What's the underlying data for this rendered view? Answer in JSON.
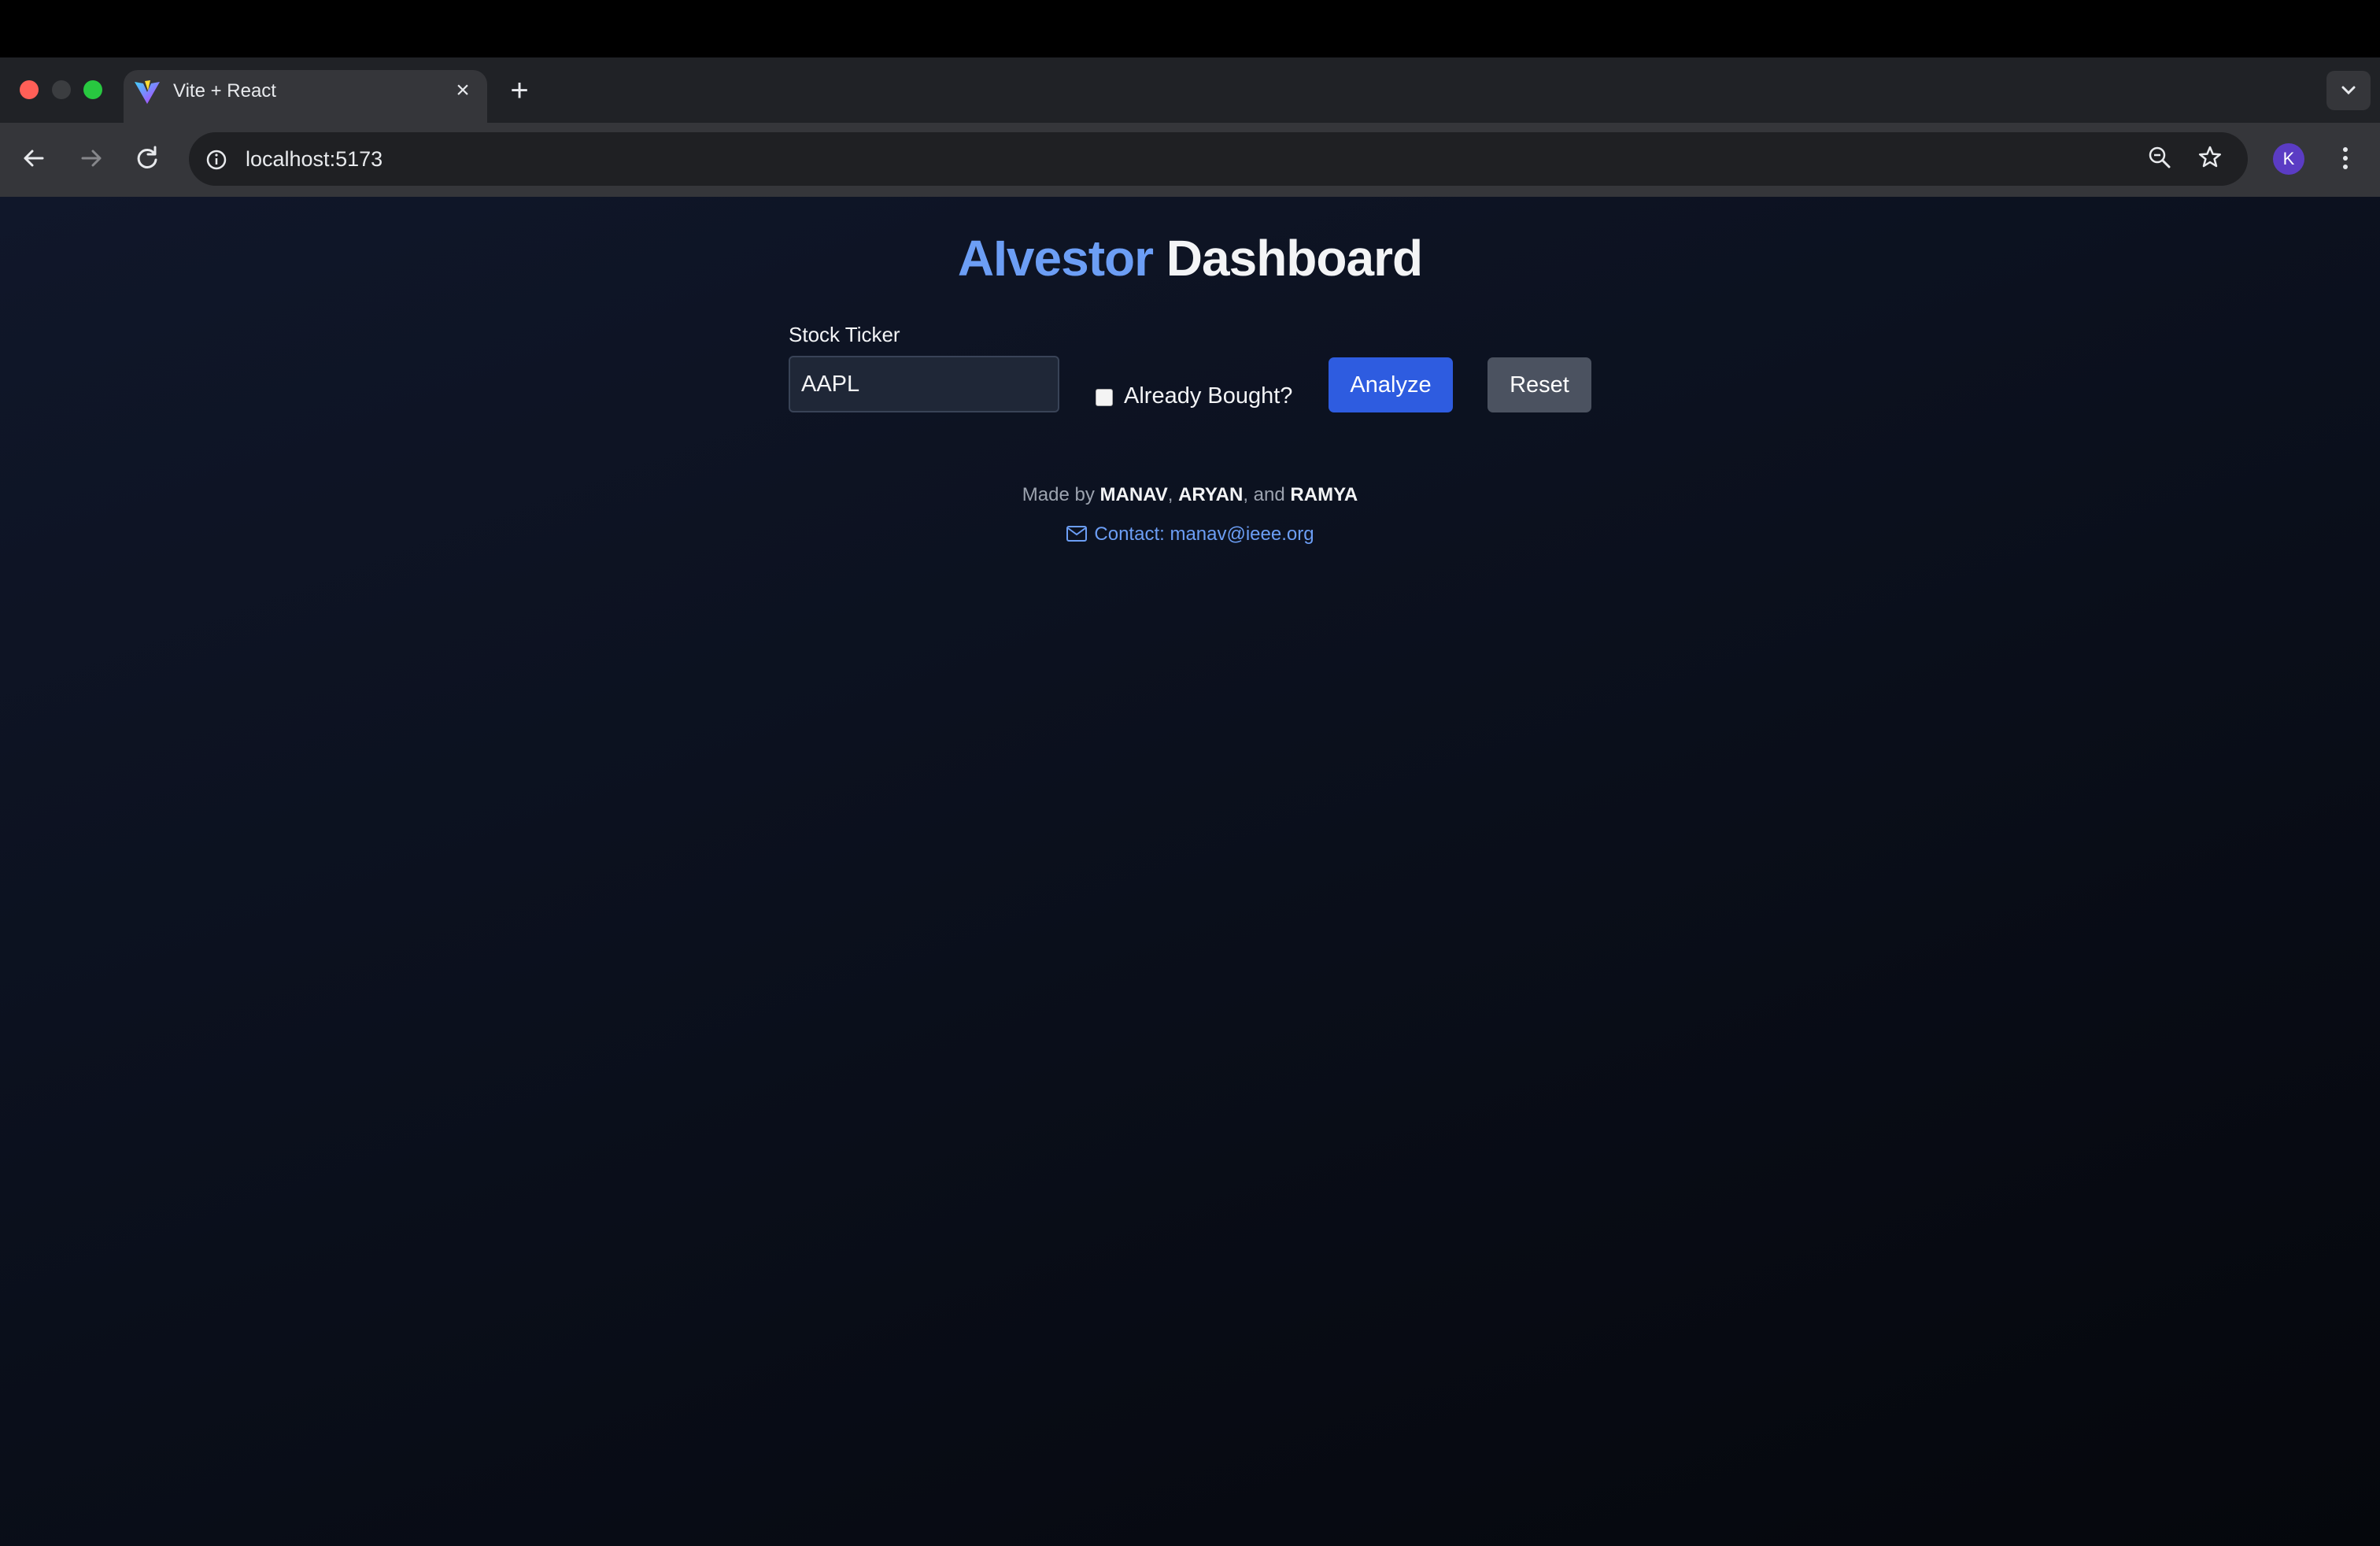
{
  "browser": {
    "tab_title": "Vite + React",
    "tab_close_glyph": "×",
    "new_tab_glyph": "+",
    "url": "localhost:5173",
    "profile_initial": "K"
  },
  "page": {
    "title_brand": "AIvestor",
    "title_rest": "Dashboard",
    "ticker_label": "Stock Ticker",
    "ticker_value": "AAPL",
    "already_bought_label": "Already Bought?",
    "already_bought_checked": false,
    "analyze_label": "Analyze",
    "reset_label": "Reset",
    "credits": {
      "prefix": "Made by",
      "name1": "MANAV",
      "sep1": ",",
      "name2": "ARYAN",
      "sep2": ", and",
      "name3": "RAMYA"
    },
    "contact_text": "Contact: manav@ieee.org"
  },
  "colors": {
    "accent_blue": "#6c9ef5",
    "analyze_button": "#2e5ce0",
    "reset_button": "#4b5260"
  }
}
